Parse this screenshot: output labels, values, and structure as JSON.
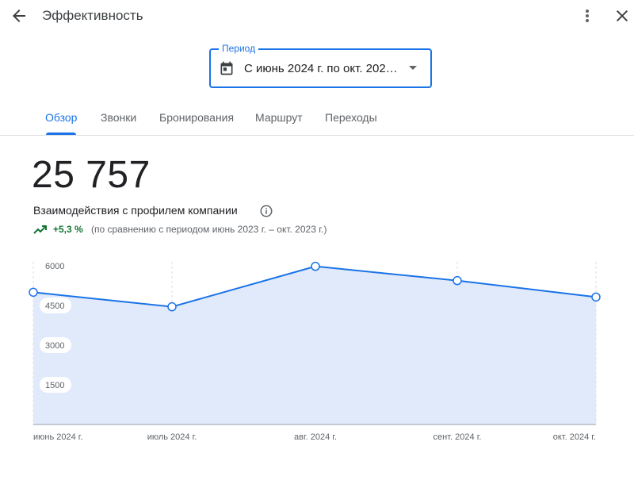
{
  "header": {
    "title": "Эффективность",
    "back_icon": "arrow-back-icon",
    "more_icon": "more-vert-icon",
    "close_icon": "close-icon"
  },
  "period": {
    "legend": "Период",
    "value": "С июнь 2024 г. по окт. 202…",
    "calendar_icon": "calendar-icon",
    "dropdown_icon": "arrow-drop-down-icon"
  },
  "tabs": [
    {
      "label": "Обзор",
      "active": true
    },
    {
      "label": "Звонки",
      "active": false
    },
    {
      "label": "Бронирования",
      "active": false
    },
    {
      "label": "Маршрут",
      "active": false
    },
    {
      "label": "Переходы",
      "active": false
    }
  ],
  "metric": {
    "total": "25 757",
    "label": "Взаимодействия с профилем компании",
    "change": "+5,3 %",
    "compare": "(по сравнению с периодом июнь 2023 г. – окт. 2023 г.)",
    "colors": {
      "accent": "#1a73e8",
      "positive": "#137333"
    }
  },
  "chart_data": {
    "type": "area",
    "categories": [
      "июнь 2024 г.",
      "июль 2024 г.",
      "авг. 2024 г.",
      "сент. 2024 г.",
      "окт. 2024 г."
    ],
    "series": [
      {
        "values": [
          5000,
          4450,
          5980,
          5440,
          4820
        ]
      }
    ],
    "yticks": [
      "1500",
      "3000",
      "4500",
      "6000"
    ],
    "ylim": [
      0,
      6000
    ],
    "grid": "vertical dashed",
    "colors": {
      "line": "#1a73e8",
      "fill": "#e1eafa",
      "axis": "#9aa0a6"
    }
  }
}
